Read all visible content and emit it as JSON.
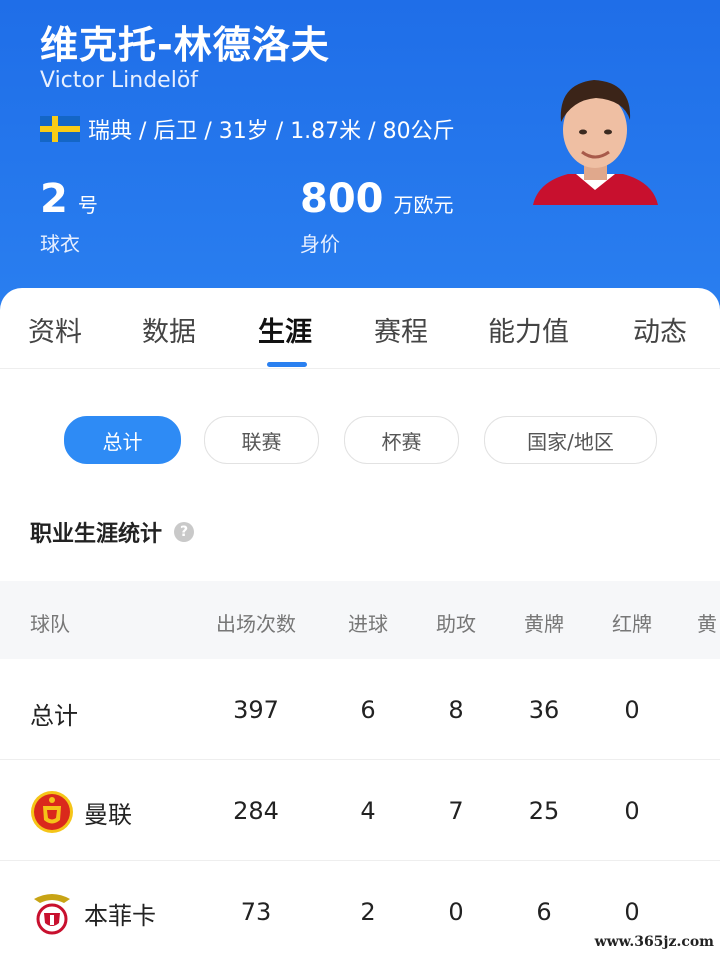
{
  "player": {
    "name_cn": "维克托-林德洛夫",
    "name_en": "Victor Lindelöf",
    "info": "瑞典 / 后卫 / 31岁 / 1.87米 / 80公斤"
  },
  "stats": {
    "jersey_number": "2",
    "jersey_unit": "号",
    "jersey_label": "球衣",
    "value_number": "800",
    "value_unit": "万欧元",
    "value_label": "身价"
  },
  "tabs": [
    {
      "label": "资料"
    },
    {
      "label": "数据"
    },
    {
      "label": "生涯",
      "active": true
    },
    {
      "label": "赛程"
    },
    {
      "label": "能力值"
    },
    {
      "label": "动态"
    }
  ],
  "filters": [
    {
      "label": "总计",
      "active": true
    },
    {
      "label": "联赛"
    },
    {
      "label": "杯赛"
    },
    {
      "label": "国家/地区"
    }
  ],
  "section_title": "职业生涯统计",
  "table": {
    "headers": [
      "球队",
      "出场次数",
      "进球",
      "助攻",
      "黄牌",
      "红牌",
      "黄"
    ],
    "rows": [
      {
        "team": "总计",
        "apps": "397",
        "goals": "6",
        "assists": "8",
        "yellow": "36",
        "red": "0"
      },
      {
        "team": "曼联",
        "apps": "284",
        "goals": "4",
        "assists": "7",
        "yellow": "25",
        "red": "0",
        "crest": "manutd-crest-icon"
      },
      {
        "team": "本菲卡",
        "apps": "73",
        "goals": "2",
        "assists": "0",
        "yellow": "6",
        "red": "0",
        "crest": "benfica-crest-icon"
      }
    ]
  },
  "watermark": "www.365jz.com",
  "colors": {
    "header_blue": "#2479ee",
    "accent": "#2e8bf5"
  }
}
